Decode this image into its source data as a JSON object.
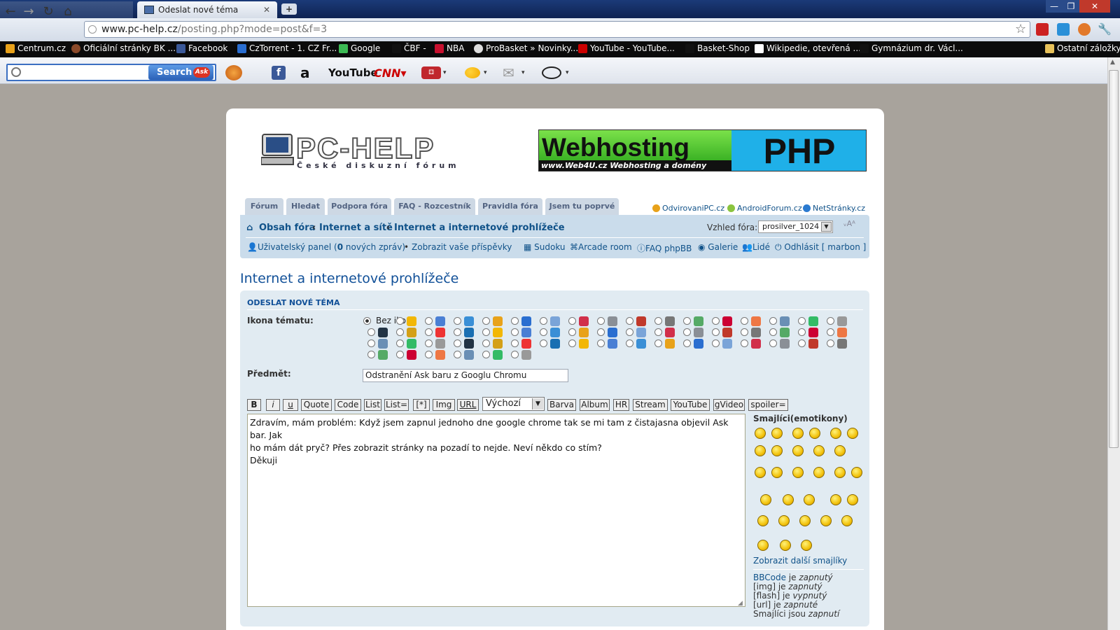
{
  "browser": {
    "tabs": [
      {
        "label": ""
      },
      {
        "label": "Odeslat nové téma"
      }
    ],
    "newtab_label": "+",
    "window_buttons": {
      "minimize": "—",
      "maximize": "❐",
      "close": "✕"
    },
    "url_host": "www.pc-help.cz",
    "url_path": "/posting.php?mode=post&f=3"
  },
  "bookmarks": [
    {
      "label": "Centrum.cz",
      "color": "#e9a21a"
    },
    {
      "label": "Oficiální stránky BK ...",
      "color": "#8b4a2a"
    },
    {
      "label": "Facebook",
      "color": "#3b5998"
    },
    {
      "label": "CzTorrent - 1. CZ Fr...",
      "color": "#2a6ed0"
    },
    {
      "label": "Google",
      "color": "#3cba54"
    },
    {
      "label": "ČBF -",
      "color": "#111111"
    },
    {
      "label": "NBA",
      "color": "#c8102e"
    },
    {
      "label": "ProBasket » Novinky...",
      "color": "#dddddd"
    },
    {
      "label": "YouTube - YouTube...",
      "color": "#cc0000"
    },
    {
      "label": "Basket-Shop",
      "color": "#111111"
    },
    {
      "label": "Wikipedie, otevřená ...",
      "color": "#ffffff"
    },
    {
      "label": "Gymnázium dr. Václ...",
      "color": "#111111"
    },
    {
      "label": "Ostatní záložky",
      "color": "#e8c25a"
    }
  ],
  "ask_toolbar": {
    "search_placeholder": "",
    "search_button": "Search",
    "ask_logo": "Ask",
    "youtube": "YouTube",
    "cnn": "CNN",
    "amazon": "a"
  },
  "site": {
    "logo": "PC-HELP",
    "logo_sub": "České diskuzní fórum",
    "banner_left": "Webhosting",
    "banner_sub": "www.Web4U.cz  Webhosting a domény",
    "banner_right": "PHP"
  },
  "nav_tabs": [
    "Fórum",
    "Hledat",
    "Podpora fóra",
    "FAQ - Rozcestník",
    "Pravidla fóra",
    "Jsem tu poprvé"
  ],
  "partners": [
    {
      "label": "OdvirovaniPC.cz",
      "color": "#e8a21a"
    },
    {
      "label": "AndroidForum.cz",
      "color": "#8ac43f"
    },
    {
      "label": "NetStránky.cz",
      "color": "#2a7ad0"
    }
  ],
  "breadcrumb": {
    "home": "Obsah fóra",
    "sep": "‹",
    "level1": "Internet a sítě",
    "level2": "Internet a internetové prohlížeče"
  },
  "skin": {
    "label": "Vzhled fóra:",
    "value": "prosilver_1024",
    "fontsize": "ᵥAᴬ"
  },
  "userbar": {
    "panel": "Uživatelský panel (",
    "count": "0",
    "panel_rest": " nových zpráv)",
    "bullet": "•",
    "my_posts": "Zobrazit vaše příspěvky",
    "links": [
      "Sudoku",
      "Arcade room",
      "FAQ phpBB",
      "Galerie",
      "Lidé",
      "Odhlásit [ marbon ]"
    ]
  },
  "page_title": "Internet a internetové prohlížeče",
  "post": {
    "heading": "ODESLAT NOVÉ TÉMA",
    "icon_label": "Ikona tématu:",
    "no_icon": "Bez ikony",
    "subject_label": "Předmět:",
    "subject_value": "Odstranění Ask baru z Googlu Chromu",
    "bbcode_buttons": [
      "B",
      "i",
      "u",
      "Quote",
      "Code",
      "List",
      "List=",
      "[*]",
      "Img",
      "URL"
    ],
    "font_select": "Výchozí",
    "bbcode_buttons2": [
      "Barva",
      "Album",
      "HR",
      "Stream",
      "YouTube",
      "gVideo",
      "spoiler="
    ],
    "message": "Zdravím, mám problém: Když jsem zapnul jednoho dne google chrome tak se mi tam z čistajasna objevil Ask bar. Jak\nho mám dát pryč? Přes zobrazit stránky na pozadí to nejde. Neví někdo co stím?\nDěkuji",
    "smilies_title": "Smajlíci(emotikony)",
    "more_smilies": "Zobrazit další smajlíky",
    "bbinfo": [
      {
        "a": "BBCode",
        "b": " je ",
        "c": "zapnutý"
      },
      {
        "a": "[img]",
        "b": " je ",
        "c": "zapnutý"
      },
      {
        "a": "[flash]",
        "b": " je ",
        "c": "vypnutý"
      },
      {
        "a": "[url]",
        "b": " je ",
        "c": "zapnuté"
      },
      {
        "a": "Smajlíci",
        "b": " jsou ",
        "c": "zapnutí"
      }
    ]
  },
  "colors": {
    "link": "#105289",
    "title": "#115098",
    "panel": "#cadceb",
    "form_bg": "#e1ebf2"
  }
}
